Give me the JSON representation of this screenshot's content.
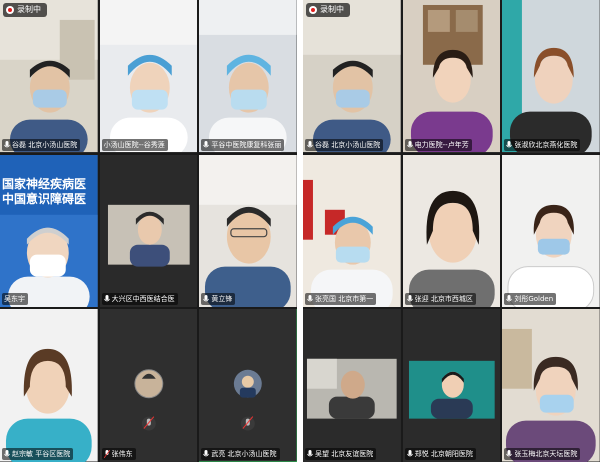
{
  "recording": {
    "label": "录制中",
    "icon": "cloud-record-icon"
  },
  "left_panel": {
    "tiles": [
      {
        "name": "谷磊  北京小汤山医院"
      },
      {
        "name": "小汤山医院--谷秀莲"
      },
      {
        "name": "平谷中医院康复科张丽"
      },
      {
        "name": "吴东宇",
        "banner_lines": [
          "国家神经疾病医",
          "中国意识障碍医"
        ]
      },
      {
        "name": "大兴区中西医结合医"
      },
      {
        "name": "黄立锋"
      },
      {
        "name": "赵宗敏  平谷区医院"
      },
      {
        "name": "张伟东"
      },
      {
        "name": "武亮  北京小汤山医院",
        "active": true
      }
    ]
  },
  "right_panel": {
    "tiles": [
      {
        "name": "谷磊  北京小汤山医院"
      },
      {
        "name": "电力医院--卢年芳"
      },
      {
        "name": "张淑欣北京燕化医院"
      },
      {
        "name": "张亮国  北京市第一"
      },
      {
        "name": "张迎  北京市西城区"
      },
      {
        "name": "刘彤Golden"
      },
      {
        "name": "吴望  北京友谊医院"
      },
      {
        "name": "郑悦  北京朝阳医院"
      },
      {
        "name": "张玉梅北京天坛医院"
      }
    ]
  },
  "colors": {
    "active_speaker": "#2bd45f",
    "recording_dot": "#e02020"
  }
}
